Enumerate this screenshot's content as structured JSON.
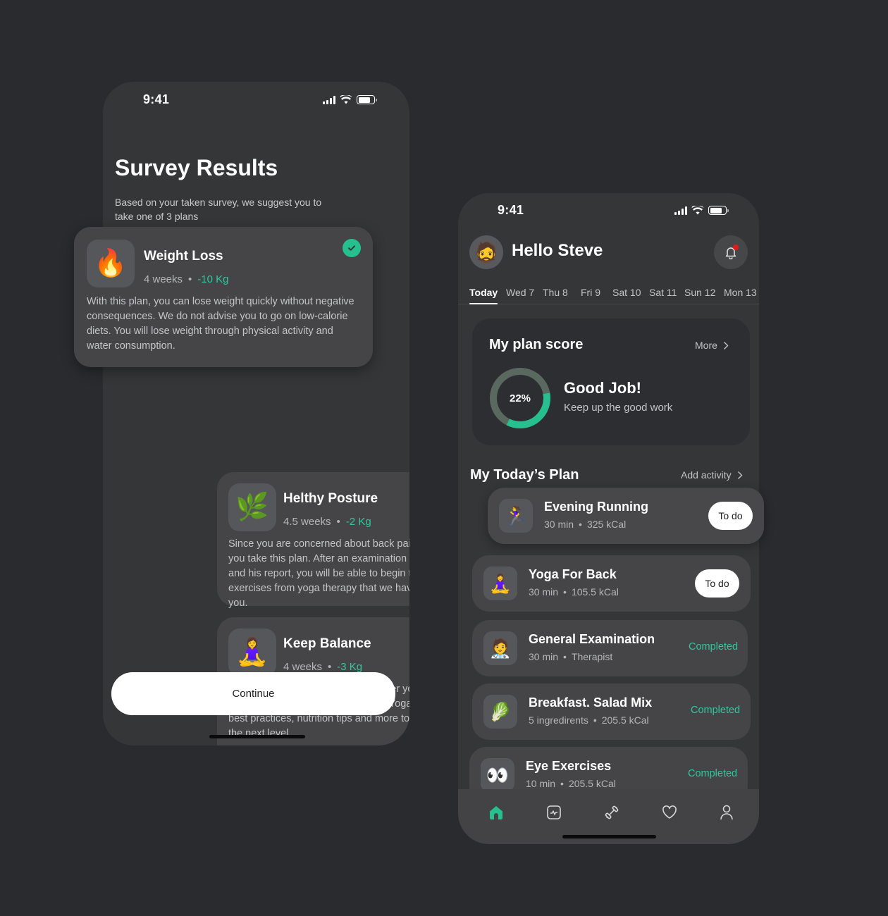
{
  "colors": {
    "background": "#2a2b2e",
    "phone": "#353638",
    "card": "#454547",
    "accent": "#2fc89a",
    "check": "#25c08e",
    "notification_dot": "#e01b1b"
  },
  "survey_screen": {
    "status_bar": {
      "time": "9:41"
    },
    "title": "Survey Results",
    "subtitle": "Based on  your taken survey, we suggest you to take one of 3 plans",
    "plans": [
      {
        "icon": "fire-emoji",
        "emoji": "🔥",
        "name": "Weight Loss",
        "duration": "4 weeks",
        "weight_change": "-10 Kg",
        "description": "With this plan, you can lose weight quickly without negative consequences. We do not advise you to go on low-calorie diets. You will lose weight through physical activity and water consumption.",
        "selected": true
      },
      {
        "icon": "herb-emoji",
        "emoji": "🌿",
        "name": "Helthy Posture",
        "duration": "4.5 weeks",
        "weight_change": "-2 Kg",
        "description": "Since you are concerned about back pain, we suggest you take this plan. After an examination with a specialist and his report, you will be able to begin the eco-friendly exercises from yoga therapy that we have selected for you.",
        "selected": false
      },
      {
        "icon": "yoga-emoji",
        "emoji": "🧘‍♀️",
        "name": "Keep Balance",
        "duration": "4 weeks",
        "weight_change": "-3 Kg",
        "description": "Since you are often stressed, we offer you a special plan for maintaining balance in your life. Yoga and meditation best practices, nutrition tips and more to take your life to the next level.",
        "selected": false
      }
    ],
    "continue_label": "Continue"
  },
  "home_screen": {
    "status_bar": {
      "time": "9:41"
    },
    "avatar_emoji": "🧔",
    "greeting": "Hello Steve",
    "day_tabs": [
      {
        "label": "Today",
        "active": true
      },
      {
        "label": "Wed 7",
        "active": false
      },
      {
        "label": "Thu 8",
        "active": false
      },
      {
        "label": "Fri 9",
        "active": false
      },
      {
        "label": "Sat 10",
        "active": false
      },
      {
        "label": "Sat 11",
        "active": false
      },
      {
        "label": "Sun 12",
        "active": false
      },
      {
        "label": "Mon 13",
        "active": false
      }
    ],
    "plan_score": {
      "title": "My  plan score",
      "more_label": "More",
      "percent": 22,
      "percent_label": "22%",
      "headline": "Good Job!",
      "subtext": "Keep up the good work"
    },
    "today_plan": {
      "title": "My Today’s Plan",
      "add_label": "Add activity",
      "activities": [
        {
          "emoji": "🏃‍♀️",
          "name": "Evening Running",
          "detail1": "30 min",
          "detail2": "325 kCal",
          "status": "todo",
          "status_label": "To do"
        },
        {
          "emoji": "🧘‍♀️",
          "name": "Yoga For Back",
          "detail1": "30 min",
          "detail2": "105.5 kCal",
          "status": "todo",
          "status_label": "To do"
        },
        {
          "emoji": "🧑‍⚕️",
          "name": "General Examination",
          "detail1": "30 min",
          "detail2": "Therapist",
          "status": "completed",
          "status_label": "Completed"
        },
        {
          "emoji": "🥬",
          "name": "Breakfast. Salad Mix",
          "detail1": "5 ingredirents",
          "detail2": "205.5 kCal",
          "status": "completed",
          "status_label": "Completed"
        },
        {
          "emoji": "👀",
          "name": "Eye Exercises",
          "detail1": "10 min",
          "detail2": "205.5 kCal",
          "status": "completed",
          "status_label": "Completed"
        }
      ]
    },
    "tab_bar": [
      {
        "icon": "home-icon",
        "active": true
      },
      {
        "icon": "activity-chart-icon",
        "active": false
      },
      {
        "icon": "dumbbell-icon",
        "active": false
      },
      {
        "icon": "heart-icon",
        "active": false
      },
      {
        "icon": "profile-icon",
        "active": false
      }
    ]
  }
}
